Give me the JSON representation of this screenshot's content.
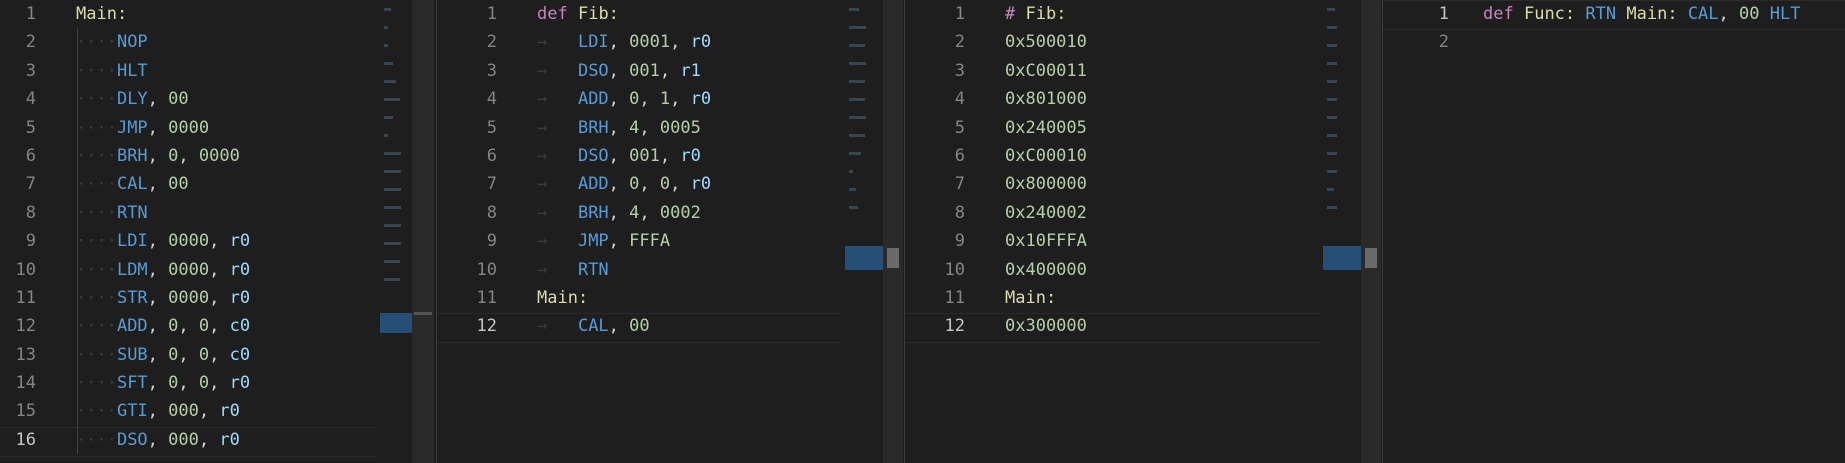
{
  "editors": [
    {
      "id": "main-asm",
      "active_line": 16,
      "lines": [
        {
          "n": "1",
          "t": [
            [
              "label",
              "Main:"
            ]
          ]
        },
        {
          "n": "2",
          "t": [
            [
              "op",
              "NOP"
            ]
          ]
        },
        {
          "n": "3",
          "t": [
            [
              "op",
              "HLT"
            ]
          ]
        },
        {
          "n": "4",
          "t": [
            [
              "op",
              "DLY"
            ],
            [
              "pn",
              ", "
            ],
            [
              "num",
              "00"
            ]
          ]
        },
        {
          "n": "5",
          "t": [
            [
              "op",
              "JMP"
            ],
            [
              "pn",
              ", "
            ],
            [
              "num",
              "0000"
            ]
          ]
        },
        {
          "n": "6",
          "t": [
            [
              "op",
              "BRH"
            ],
            [
              "pn",
              ", "
            ],
            [
              "num",
              "0"
            ],
            [
              "pn",
              ", "
            ],
            [
              "num",
              "0000"
            ]
          ]
        },
        {
          "n": "7",
          "t": [
            [
              "op",
              "CAL"
            ],
            [
              "pn",
              ", "
            ],
            [
              "num",
              "00"
            ]
          ]
        },
        {
          "n": "8",
          "t": [
            [
              "op",
              "RTN"
            ]
          ]
        },
        {
          "n": "9",
          "t": [
            [
              "op",
              "LDI"
            ],
            [
              "pn",
              ", "
            ],
            [
              "num",
              "0000"
            ],
            [
              "pn",
              ", "
            ],
            [
              "reg",
              "r0"
            ]
          ]
        },
        {
          "n": "10",
          "t": [
            [
              "op",
              "LDM"
            ],
            [
              "pn",
              ", "
            ],
            [
              "num",
              "0000"
            ],
            [
              "pn",
              ", "
            ],
            [
              "reg",
              "r0"
            ]
          ]
        },
        {
          "n": "11",
          "t": [
            [
              "op",
              "STR"
            ],
            [
              "pn",
              ", "
            ],
            [
              "num",
              "0000"
            ],
            [
              "pn",
              ", "
            ],
            [
              "reg",
              "r0"
            ]
          ]
        },
        {
          "n": "12",
          "t": [
            [
              "op",
              "ADD"
            ],
            [
              "pn",
              ", "
            ],
            [
              "num",
              "0"
            ],
            [
              "pn",
              ", "
            ],
            [
              "num",
              "0"
            ],
            [
              "pn",
              ", "
            ],
            [
              "reg",
              "c0"
            ]
          ]
        },
        {
          "n": "13",
          "t": [
            [
              "op",
              "SUB"
            ],
            [
              "pn",
              ", "
            ],
            [
              "num",
              "0"
            ],
            [
              "pn",
              ", "
            ],
            [
              "num",
              "0"
            ],
            [
              "pn",
              ", "
            ],
            [
              "reg",
              "c0"
            ]
          ]
        },
        {
          "n": "14",
          "t": [
            [
              "op",
              "SFT"
            ],
            [
              "pn",
              ", "
            ],
            [
              "num",
              "0"
            ],
            [
              "pn",
              ", "
            ],
            [
              "num",
              "0"
            ],
            [
              "pn",
              ", "
            ],
            [
              "reg",
              "r0"
            ]
          ]
        },
        {
          "n": "15",
          "t": [
            [
              "op",
              "GTI"
            ],
            [
              "pn",
              ", "
            ],
            [
              "num",
              "000"
            ],
            [
              "pn",
              ", "
            ],
            [
              "reg",
              "r0"
            ]
          ]
        },
        {
          "n": "16",
          "t": [
            [
              "op",
              "DSO"
            ],
            [
              "pn",
              ", "
            ],
            [
              "num",
              "000"
            ],
            [
              "pn",
              ", "
            ],
            [
              "reg",
              "r0"
            ]
          ]
        }
      ]
    },
    {
      "id": "fib-asm",
      "active_line": 12,
      "lines": [
        {
          "n": "1",
          "t": [
            [
              "kw",
              "def"
            ],
            [
              "pn",
              " "
            ],
            [
              "label",
              "Fib:"
            ]
          ]
        },
        {
          "n": "2",
          "t": [
            [
              "op",
              "LDI"
            ],
            [
              "pn",
              ", "
            ],
            [
              "num",
              "0001"
            ],
            [
              "pn",
              ", "
            ],
            [
              "reg",
              "r0"
            ]
          ]
        },
        {
          "n": "3",
          "t": [
            [
              "op",
              "DSO"
            ],
            [
              "pn",
              ", "
            ],
            [
              "num",
              "001"
            ],
            [
              "pn",
              ", "
            ],
            [
              "reg",
              "r1"
            ]
          ]
        },
        {
          "n": "4",
          "t": [
            [
              "op",
              "ADD"
            ],
            [
              "pn",
              ", "
            ],
            [
              "num",
              "0"
            ],
            [
              "pn",
              ", "
            ],
            [
              "num",
              "1"
            ],
            [
              "pn",
              ", "
            ],
            [
              "reg",
              "r0"
            ]
          ]
        },
        {
          "n": "5",
          "t": [
            [
              "op",
              "BRH"
            ],
            [
              "pn",
              ", "
            ],
            [
              "num",
              "4"
            ],
            [
              "pn",
              ", "
            ],
            [
              "num",
              "0005"
            ]
          ]
        },
        {
          "n": "6",
          "t": [
            [
              "op",
              "DSO"
            ],
            [
              "pn",
              ", "
            ],
            [
              "num",
              "001"
            ],
            [
              "pn",
              ", "
            ],
            [
              "reg",
              "r0"
            ]
          ]
        },
        {
          "n": "7",
          "t": [
            [
              "op",
              "ADD"
            ],
            [
              "pn",
              ", "
            ],
            [
              "num",
              "0"
            ],
            [
              "pn",
              ", "
            ],
            [
              "num",
              "0"
            ],
            [
              "pn",
              ", "
            ],
            [
              "reg",
              "r0"
            ]
          ]
        },
        {
          "n": "8",
          "t": [
            [
              "op",
              "BRH"
            ],
            [
              "pn",
              ", "
            ],
            [
              "num",
              "4"
            ],
            [
              "pn",
              ", "
            ],
            [
              "num",
              "0002"
            ]
          ]
        },
        {
          "n": "9",
          "t": [
            [
              "op",
              "JMP"
            ],
            [
              "pn",
              ", "
            ],
            [
              "num",
              "FFFA"
            ]
          ]
        },
        {
          "n": "10",
          "t": [
            [
              "op",
              "RTN"
            ]
          ]
        },
        {
          "n": "11",
          "t": [
            [
              "label",
              "Main:"
            ]
          ]
        },
        {
          "n": "12",
          "t": [
            [
              "op",
              "CAL"
            ],
            [
              "pn",
              ", "
            ],
            [
              "num",
              "00"
            ]
          ]
        }
      ]
    },
    {
      "id": "fib-hex",
      "active_line": 12,
      "lines": [
        {
          "n": "1",
          "t": [
            [
              "kw",
              "#"
            ],
            [
              "pn",
              " "
            ],
            [
              "label",
              "Fib:"
            ]
          ]
        },
        {
          "n": "2",
          "t": [
            [
              "num",
              "0x500010"
            ]
          ]
        },
        {
          "n": "3",
          "t": [
            [
              "num",
              "0xC00011"
            ]
          ]
        },
        {
          "n": "4",
          "t": [
            [
              "num",
              "0x801000"
            ]
          ]
        },
        {
          "n": "5",
          "t": [
            [
              "num",
              "0x240005"
            ]
          ]
        },
        {
          "n": "6",
          "t": [
            [
              "num",
              "0xC00010"
            ]
          ]
        },
        {
          "n": "7",
          "t": [
            [
              "num",
              "0x800000"
            ]
          ]
        },
        {
          "n": "8",
          "t": [
            [
              "num",
              "0x240002"
            ]
          ]
        },
        {
          "n": "9",
          "t": [
            [
              "num",
              "0x10FFFA"
            ]
          ]
        },
        {
          "n": "10",
          "t": [
            [
              "num",
              "0x400000"
            ]
          ]
        },
        {
          "n": "11",
          "t": [
            [
              "label",
              "Main:"
            ]
          ]
        },
        {
          "n": "12",
          "t": [
            [
              "num",
              "0x300000"
            ]
          ]
        }
      ]
    },
    {
      "id": "func-oneline",
      "active_line": 1,
      "lines": [
        {
          "n": "1",
          "t": [
            [
              "kw",
              "def"
            ],
            [
              "pn",
              " "
            ],
            [
              "label",
              "Func:"
            ],
            [
              "pn",
              " "
            ],
            [
              "op",
              "RTN"
            ],
            [
              "pn",
              " "
            ],
            [
              "label",
              "Main:"
            ],
            [
              "pn",
              " "
            ],
            [
              "op",
              "CAL"
            ],
            [
              "pn",
              ", "
            ],
            [
              "num",
              "00"
            ],
            [
              "pn",
              " "
            ],
            [
              "op",
              "HLT"
            ]
          ]
        },
        {
          "n": "2",
          "t": []
        }
      ]
    }
  ]
}
